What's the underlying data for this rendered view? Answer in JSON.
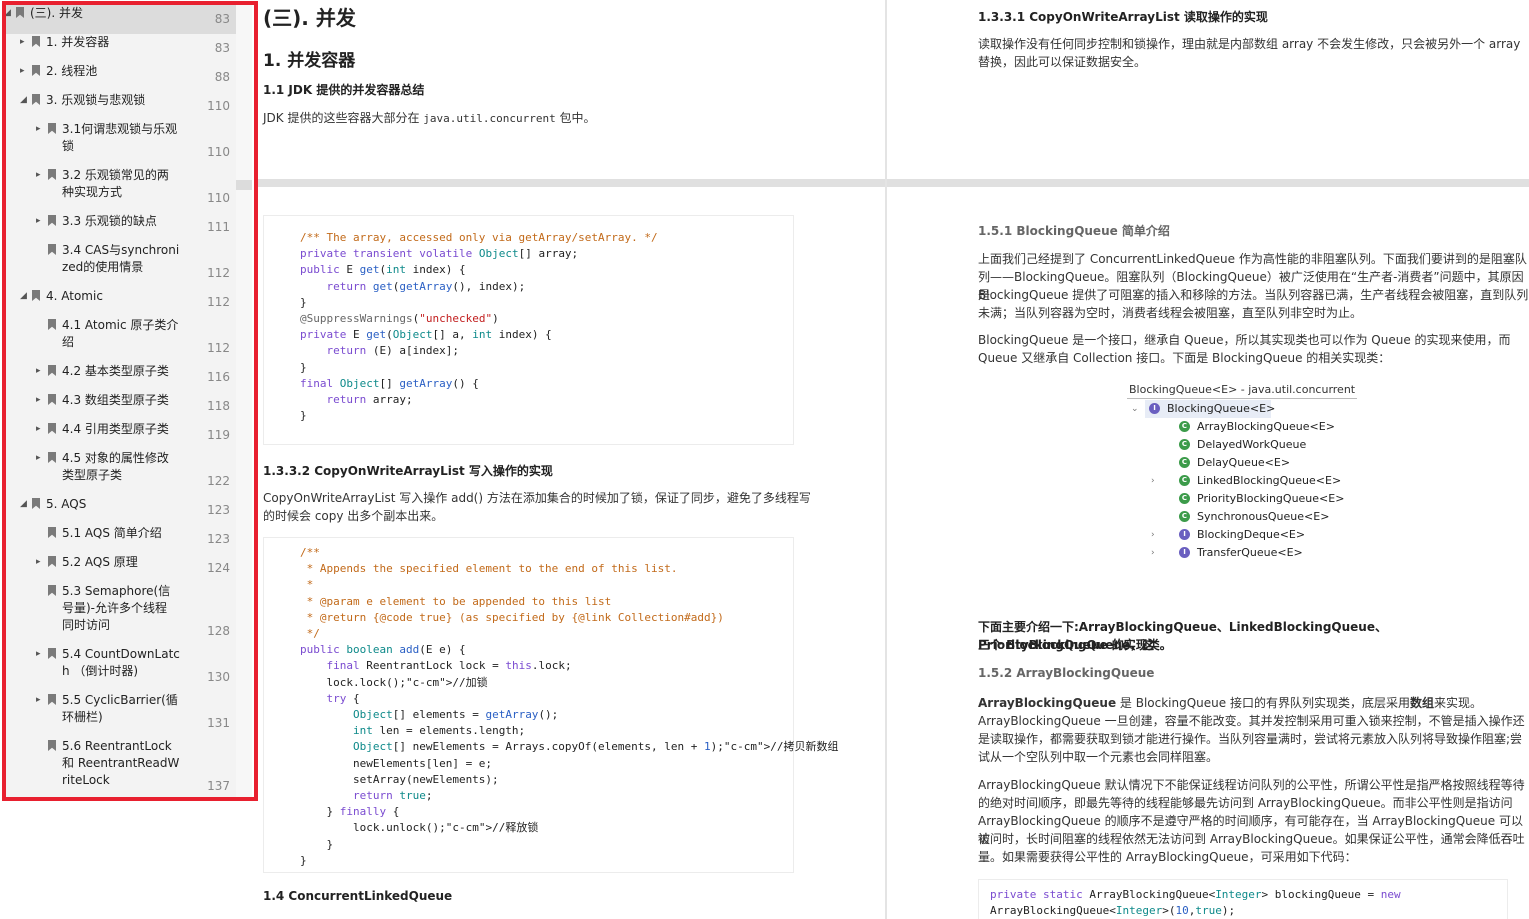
{
  "toc": {
    "items": [
      {
        "label": "(三). 并发",
        "page": "83",
        "arrow": "◢",
        "active": true
      },
      {
        "label": "1. 并发容器",
        "page": "83",
        "arrow": "▸"
      },
      {
        "label": "2. 线程池",
        "page": "88",
        "arrow": "▸"
      },
      {
        "label": "3. 乐观锁与悲观锁",
        "page": "110",
        "arrow": "◢"
      },
      {
        "label": "3.1何谓悲观锁与乐观\n锁",
        "page": "110",
        "arrow": "▸"
      },
      {
        "label": "3.2 乐观锁常见的两\n种实现方式",
        "page": "110",
        "arrow": "▸"
      },
      {
        "label": "3.3 乐观锁的缺点",
        "page": "111",
        "arrow": "▸"
      },
      {
        "label": "3.4 CAS与synchroni\nzed的使用情景",
        "page": "112",
        "arrow": ""
      },
      {
        "label": "4. Atomic",
        "page": "112",
        "arrow": "◢"
      },
      {
        "label": "4.1 Atomic 原子类介\n绍",
        "page": "112",
        "arrow": ""
      },
      {
        "label": "4.2 基本类型原子类",
        "page": "116",
        "arrow": "▸"
      },
      {
        "label": "4.3 数组类型原子类",
        "page": "118",
        "arrow": "▸"
      },
      {
        "label": "4.4 引用类型原子类",
        "page": "119",
        "arrow": "▸"
      },
      {
        "label": "4.5 对象的属性修改\n类型原子类",
        "page": "122",
        "arrow": "▸"
      },
      {
        "label": "5. AQS",
        "page": "123",
        "arrow": "◢"
      },
      {
        "label": "5.1 AQS 简单介绍",
        "page": "123",
        "arrow": ""
      },
      {
        "label": "5.2 AQS 原理",
        "page": "124",
        "arrow": "▸"
      },
      {
        "label": "5.3 Semaphore(信\n号量)-允许多个线程\n同时访问",
        "page": "128",
        "arrow": ""
      },
      {
        "label": "5.4 CountDownLatc\nh （倒计时器)",
        "page": "130",
        "arrow": "▸"
      },
      {
        "label": "5.5 CyclicBarrier(循\n环栅栏)",
        "page": "131",
        "arrow": "▸"
      },
      {
        "label": "5.6 ReentrantLock\n和 ReentrantReadW\nriteLock",
        "page": "137",
        "arrow": ""
      }
    ]
  },
  "left": {
    "h_section": "(三). 并发",
    "h_concurrent": "1. 并发容器",
    "h_jdk": "1.1 JDK 提供的并发容器总结",
    "p_jdk_a": "JDK 提供的这些容器大部分在 ",
    "p_jdk_code": "java.util.concurrent",
    "p_jdk_b": " 包中。",
    "code1": [
      "/** The array, accessed only via getArray/setArray. */",
      "private transient volatile Object[] array;",
      "public E get(int index) {",
      "    return get(getArray(), index);",
      "}",
      "@SuppressWarnings(\"unchecked\")",
      "private E get(Object[] a, int index) {",
      "    return (E) a[index];",
      "}",
      "final Object[] getArray() {",
      "    return array;",
      "}"
    ],
    "h_write": "1.3.3.2 CopyOnWriteArrayList 写入操作的实现",
    "p_write_1": "CopyOnWriteArrayList 写入操作 add() 方法在添加集合的时候加了锁，保证了同步，避免了多线程写",
    "p_write_2": "的时候会 copy 出多个副本出来。",
    "code2": [
      "/**",
      " * Appends the specified element to the end of this list.",
      " *",
      " * @param e element to be appended to this list",
      " * @return {@code true} (as specified by {@link Collection#add})",
      " */",
      "public boolean add(E e) {",
      "    final ReentrantLock lock = this.lock;",
      "    lock.lock();//加锁",
      "    try {",
      "        Object[] elements = getArray();",
      "        int len = elements.length;",
      "        Object[] newElements = Arrays.copyOf(elements, len + 1);//拷贝新数组",
      "        newElements[len] = e;",
      "        setArray(newElements);",
      "        return true;",
      "    } finally {",
      "        lock.unlock();//释放锁",
      "    }",
      "}"
    ],
    "h_clq": "1.4 ConcurrentLinkedQueue"
  },
  "right": {
    "h_read": "1.3.3.1 CopyOnWriteArrayList 读取操作的实现",
    "p_read_1": "读取操作没有任何同步控制和锁操作，理由就是内部数组 array 不会发生修改，只会被另外一个 array",
    "p_read_2": "替换，因此可以保证数据安全。",
    "h_bq": "1.5.1 BlockingQueue 简单介绍",
    "p_bq_1": "上面我们己经提到了 ConcurrentLinkedQueue 作为高性能的非阻塞队列。下面我们要讲到的是阻塞队",
    "p_bq_2": "列——BlockingQueue。阻塞队列（BlockingQueue）被广泛使用在“生产者-消费者”问题中，其原因是",
    "p_bq_3": "BlockingQueue 提供了可阻塞的插入和移除的方法。当队列容器已满，生产者线程会被阻塞，直到队列",
    "p_bq_4": "未满；当队列容器为空时，消费者线程会被阻塞，直至队列非空时为止。",
    "p_bq_5": "BlockingQueue 是一个接口，继承自 Queue，所以其实现类也可以作为 Queue 的实现来使用，而",
    "p_bq_6": "Queue 又继承自 Collection 接口。下面是 BlockingQueue 的相关实现类：",
    "hier_title": "BlockingQueue<E> - java.util.concurrent",
    "hier_items": [
      {
        "label": "BlockingQueue<E>",
        "icon": "I",
        "kind": "interface",
        "twisty": "⌄"
      },
      {
        "label": "ArrayBlockingQueue<E>",
        "icon": "C",
        "kind": "class",
        "twisty": ""
      },
      {
        "label": "DelayedWorkQueue",
        "icon": "C",
        "kind": "class",
        "twisty": ""
      },
      {
        "label": "DelayQueue<E>",
        "icon": "C",
        "kind": "class",
        "twisty": ""
      },
      {
        "label": "LinkedBlockingQueue<E>",
        "icon": "C",
        "kind": "class",
        "twisty": "›"
      },
      {
        "label": "PriorityBlockingQueue<E>",
        "icon": "C",
        "kind": "class",
        "twisty": ""
      },
      {
        "label": "SynchronousQueue<E>",
        "icon": "C",
        "kind": "class",
        "twisty": ""
      },
      {
        "label": "BlockingDeque<E>",
        "icon": "I",
        "kind": "interface",
        "twisty": "›"
      },
      {
        "label": "TransferQueue<E>",
        "icon": "I",
        "kind": "interface",
        "twisty": "›"
      }
    ],
    "p_intro_1": "下面主要介绍一下:ArrayBlockingQueue、LinkedBlockingQueue、PriorityBlockingQueue，这",
    "p_intro_2": "三个 BlockingQueue 的实现类。",
    "h_abq": "1.5.2 ArrayBlockingQueue",
    "p_abq_bold1": "ArrayBlockingQueue",
    "p_abq_1a": " 是 BlockingQueue 接口的有界队列实现类，底层采用",
    "p_abq_bold2": "数组",
    "p_abq_1b": "来实现。",
    "p_abq_2": "ArrayBlockingQueue 一旦创建，容量不能改变。其并发控制采用可重入锁来控制，不管是插入操作还",
    "p_abq_3": "是读取操作，都需要获取到锁才能进行操作。当队列容量满时，尝试将元素放入队列将导致操作阻塞;尝",
    "p_abq_4": "试从一个空队列中取一个元素也会同样阻塞。",
    "p_fair_1": "ArrayBlockingQueue 默认情况下不能保证线程访问队列的公平性，所谓公平性是指严格按照线程等待",
    "p_fair_2": "的绝对时间顺序，即最先等待的线程能够最先访问到 ArrayBlockingQueue。而非公平性则是指访问",
    "p_fair_3": "ArrayBlockingQueue 的顺序不是遵守严格的时间顺序，有可能存在，当 ArrayBlockingQueue 可以被",
    "p_fair_4": "访问时，长时间阻塞的线程依然无法访问到 ArrayBlockingQueue。如果保证公平性，通常会降低吞吐",
    "p_fair_5": "量。如果需要获得公平性的 ArrayBlockingQueue，可采用如下代码：",
    "code3": [
      "private static ArrayBlockingQueue<Integer> blockingQueue = new",
      "ArrayBlockingQueue<Integer>(10,true);"
    ]
  }
}
